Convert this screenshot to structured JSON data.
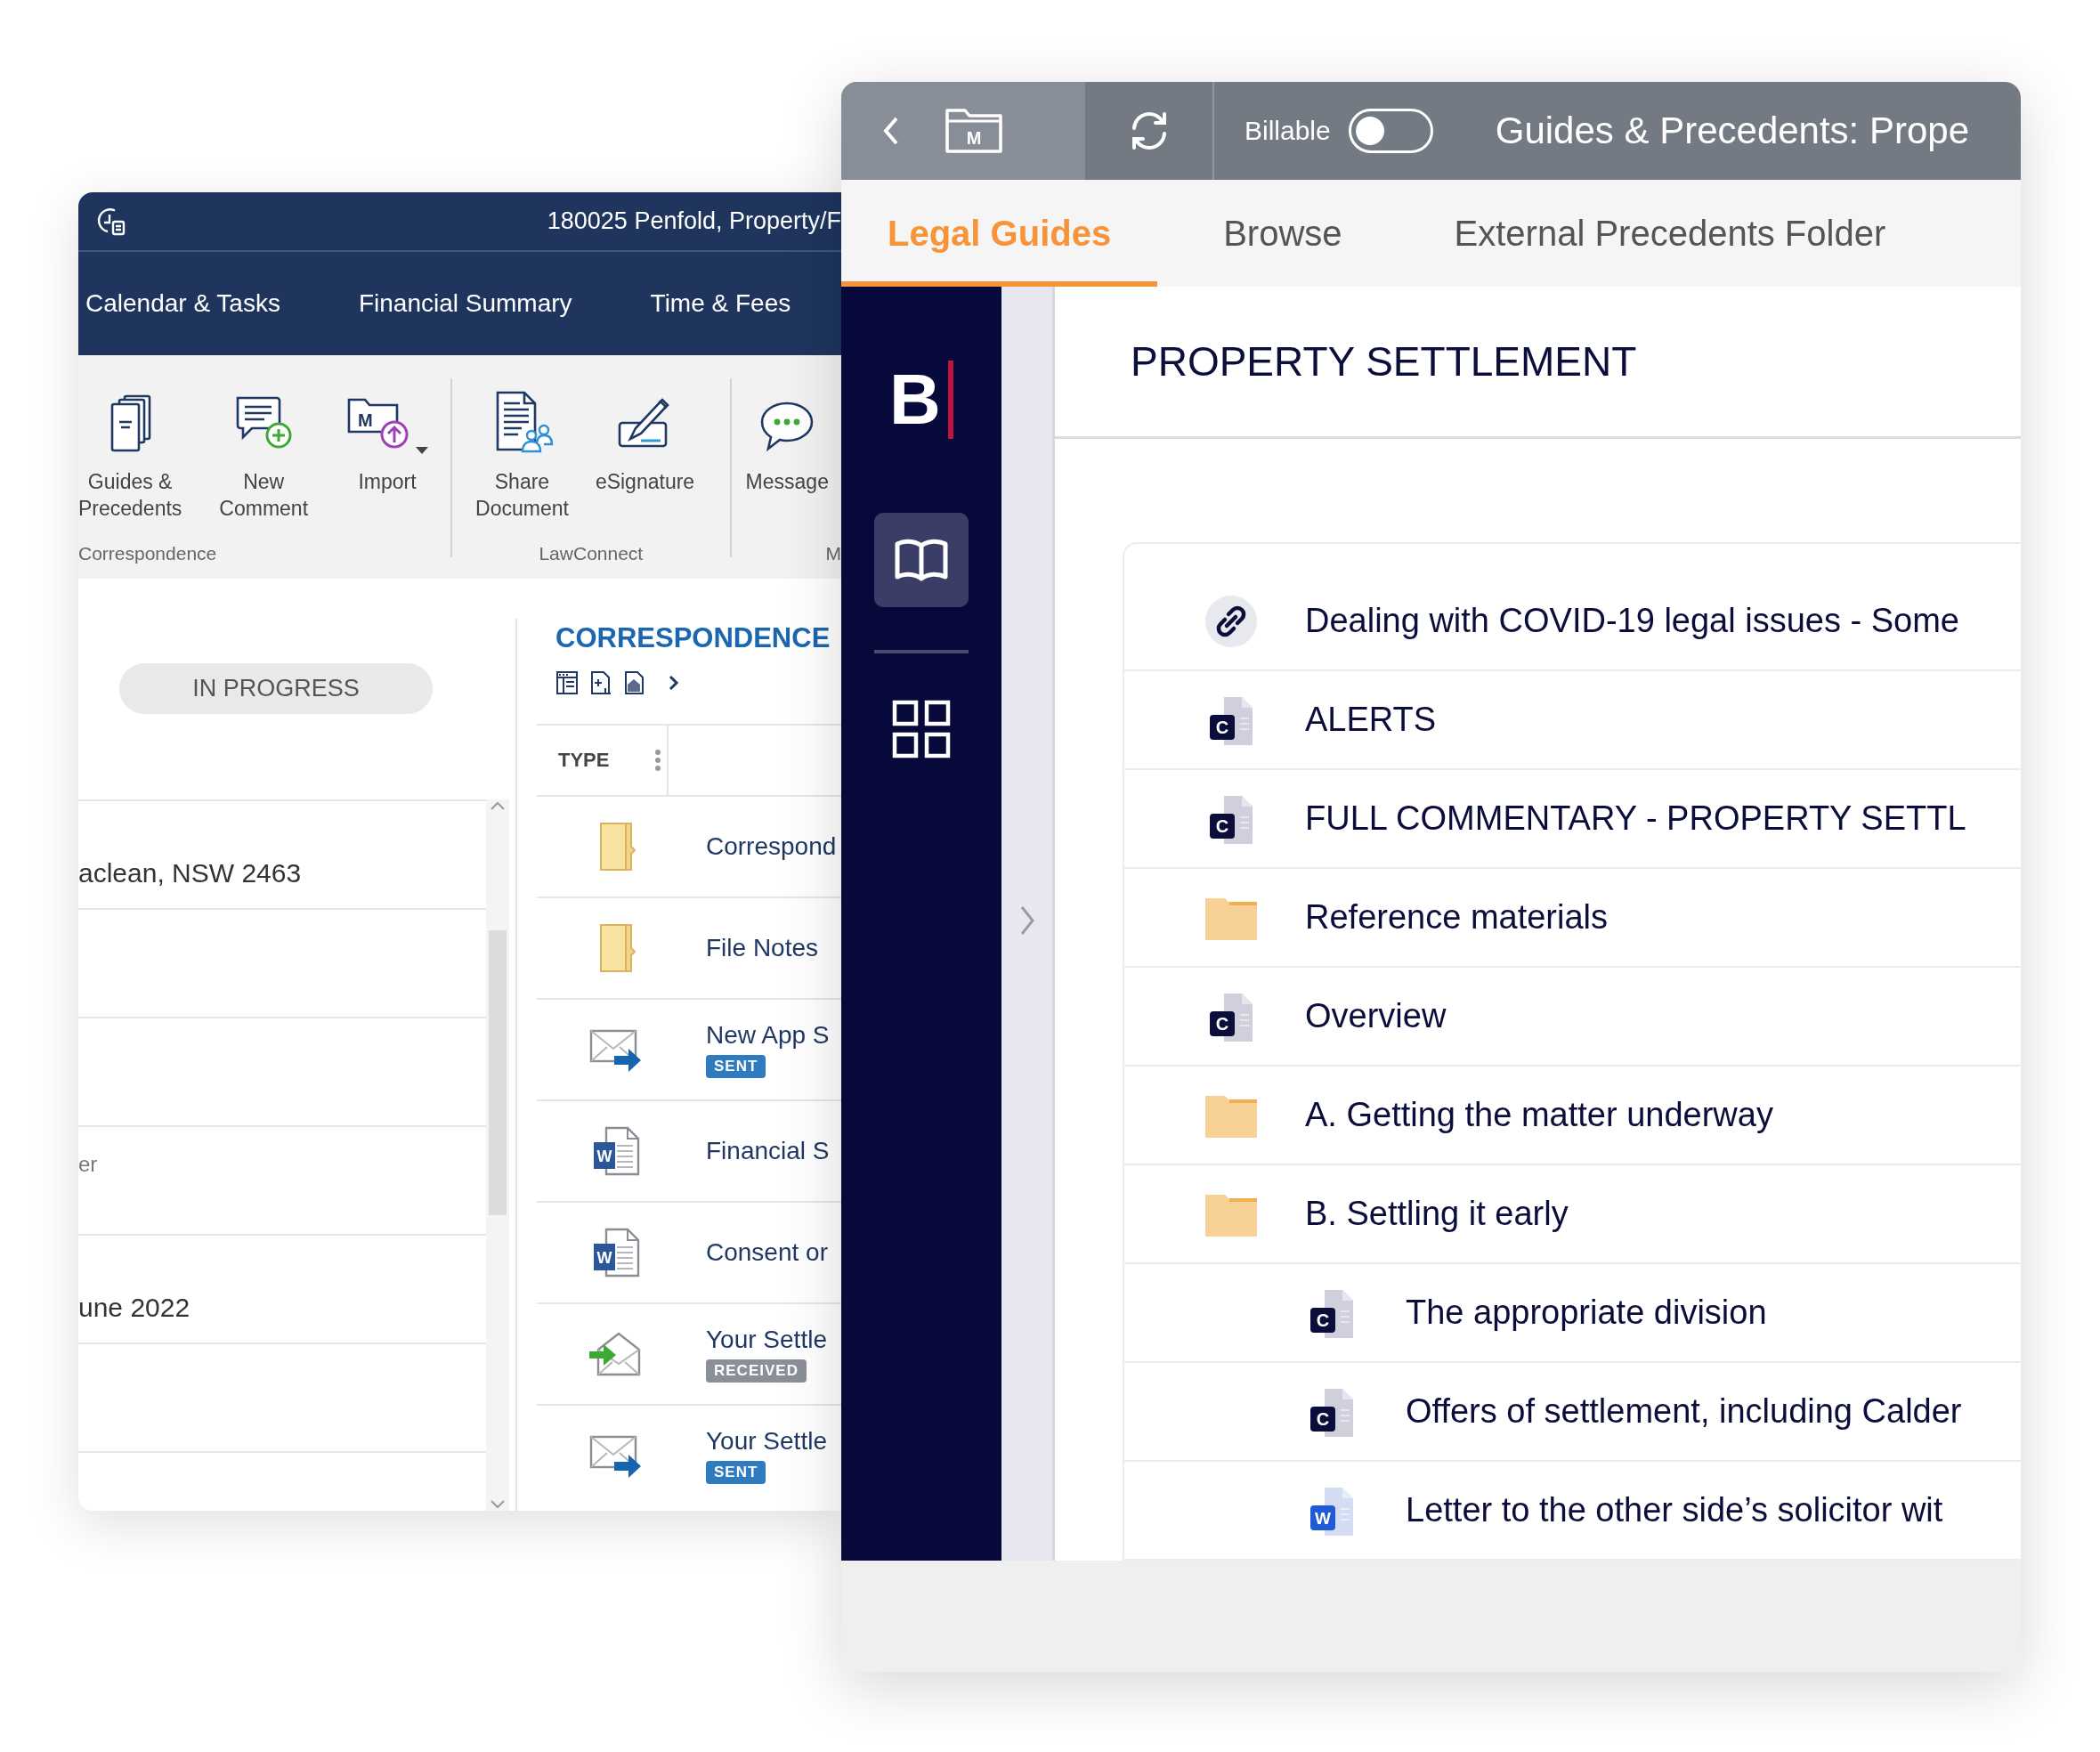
{
  "matter_window": {
    "title": "180025 Penfold, Property/F",
    "tabs": [
      {
        "label": "Calendar & Tasks",
        "selected": false
      },
      {
        "label": "Financial Summary",
        "selected": false
      },
      {
        "label": "Time & Fees",
        "selected": false
      }
    ],
    "ribbon_groups": [
      {
        "label": "Correspondence",
        "buttons": [
          {
            "kind": "guides",
            "label": "Guides & Precedents"
          },
          {
            "kind": "comment",
            "label": "New Comment"
          },
          {
            "kind": "import",
            "label": "Import",
            "icon_letter": "M",
            "has_menu": true
          }
        ]
      },
      {
        "label": "LawConnect",
        "buttons": [
          {
            "kind": "share",
            "label": "Share Document"
          },
          {
            "kind": "sign",
            "label": "eSignature"
          }
        ]
      },
      {
        "label": "M",
        "buttons": [
          {
            "kind": "message",
            "label": "Message"
          }
        ]
      }
    ],
    "status": "IN PROGRESS",
    "details": [
      {
        "kind": "value",
        "text": "aclean, NSW 2463"
      },
      {
        "kind": "label",
        "text": "er"
      },
      {
        "kind": "value",
        "text": "une 2022"
      }
    ],
    "correspondence": {
      "title": "CORRESPONDENCE",
      "column": "TYPE",
      "rows": [
        {
          "kind": "folder",
          "title": "Correspond"
        },
        {
          "kind": "folder",
          "title": "File Notes"
        },
        {
          "kind": "email_sent",
          "title": "New App S",
          "badge": {
            "label": "SENT",
            "kind": "sent"
          }
        },
        {
          "kind": "word",
          "icon_letter": "W",
          "title": "Financial S"
        },
        {
          "kind": "word",
          "icon_letter": "W",
          "title": "Consent or"
        },
        {
          "kind": "email_received",
          "title": "Your Settle",
          "badge": {
            "label": "RECEIVED",
            "kind": "received"
          }
        },
        {
          "kind": "email_sent",
          "title": "Your Settle",
          "badge": {
            "label": "SENT",
            "kind": "sent"
          }
        }
      ]
    }
  },
  "guides_window": {
    "folder_letter": "M",
    "billable": {
      "label": "Billable",
      "on": false
    },
    "title": "Guides & Precedents: Prope",
    "tabs": [
      {
        "label": "Legal Guides",
        "selected": true
      },
      {
        "label": "Browse",
        "selected": false
      },
      {
        "label": "External Precedents Folder",
        "selected": false
      }
    ],
    "logo": "B",
    "nav": [
      {
        "kind": "book",
        "selected": true
      },
      {
        "kind": "grid",
        "selected": false
      }
    ],
    "heading": "PROPERTY SETTLEMENT",
    "items": [
      {
        "kind": "link",
        "title": "Dealing with COVID-19 legal issues - Some"
      },
      {
        "kind": "commentary",
        "icon_letter": "C",
        "title": "ALERTS"
      },
      {
        "kind": "commentary",
        "icon_letter": "C",
        "title": "FULL COMMENTARY - PROPERTY SETTL"
      },
      {
        "kind": "folder",
        "title": "Reference materials"
      },
      {
        "kind": "commentary",
        "icon_letter": "C",
        "title": "Overview"
      },
      {
        "kind": "folder",
        "title": "A. Getting the matter underway"
      },
      {
        "kind": "folder",
        "title": "B. Settling it early",
        "children": [
          {
            "kind": "commentary",
            "icon_letter": "C",
            "title": "The appropriate division"
          },
          {
            "kind": "commentary",
            "icon_letter": "C",
            "title": "Offers of settlement, including Calder"
          },
          {
            "kind": "word",
            "icon_letter": "W",
            "title": "Letter to the other side’s solicitor wit"
          }
        ]
      }
    ]
  }
}
